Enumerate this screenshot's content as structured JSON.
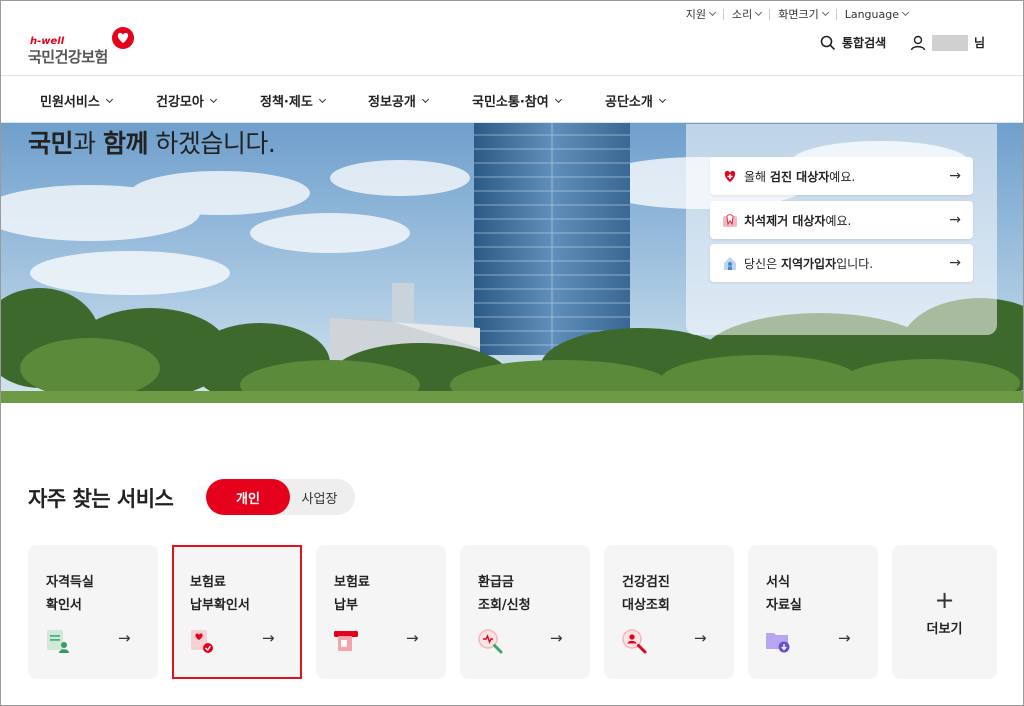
{
  "utility": {
    "support": "지원",
    "sound": "소리",
    "screen_size": "화면크기",
    "language": "Language"
  },
  "header": {
    "logo_tag": "h-well",
    "logo_name": "국민건강보험",
    "search_label": "통합검색",
    "user_suffix": "님"
  },
  "nav": {
    "items": [
      {
        "label": "민원서비스"
      },
      {
        "label": "건강모아"
      },
      {
        "label": "정책·제도"
      },
      {
        "label": "정보공개"
      },
      {
        "label": "국민소통·참여"
      },
      {
        "label": "공단소개"
      }
    ]
  },
  "hero": {
    "title_part1": "국민",
    "title_part2": "과 ",
    "title_part3": "함께",
    "title_part4": " 하겠습니다.",
    "cards": [
      {
        "prefix": "올해 ",
        "bold": "검진 대상자",
        "suffix": "예요.",
        "icon": "heart-icon"
      },
      {
        "prefix": "",
        "bold": "치석제거 대상자",
        "suffix": "예요.",
        "icon": "tooth-icon"
      },
      {
        "prefix": "당신은 ",
        "bold": "지역가입자",
        "suffix": "입니다.",
        "icon": "home-icon"
      }
    ],
    "arrow": "→"
  },
  "services": {
    "title": "자주 찾는 서비스",
    "tab_personal": "개인",
    "tab_business": "사업장",
    "items": [
      {
        "line1": "자격득실",
        "line2": "확인서",
        "icon": "certificate-user-icon"
      },
      {
        "line1": "보험료",
        "line2": "납부확인서",
        "icon": "payment-receipt-icon"
      },
      {
        "line1": "보험료",
        "line2": "납부",
        "icon": "atm-card-icon"
      },
      {
        "line1": "환급금",
        "line2": "조회/신청",
        "icon": "search-refund-icon"
      },
      {
        "line1": "건강검진",
        "line2": "대상조회",
        "icon": "search-person-icon"
      },
      {
        "line1": "서식",
        "line2": "자료실",
        "icon": "folder-download-icon"
      }
    ],
    "more_plus": "+",
    "more_label": "더보기",
    "arrow": "→"
  },
  "colors": {
    "brand_red": "#e5001b",
    "highlight": "#e0141e"
  }
}
